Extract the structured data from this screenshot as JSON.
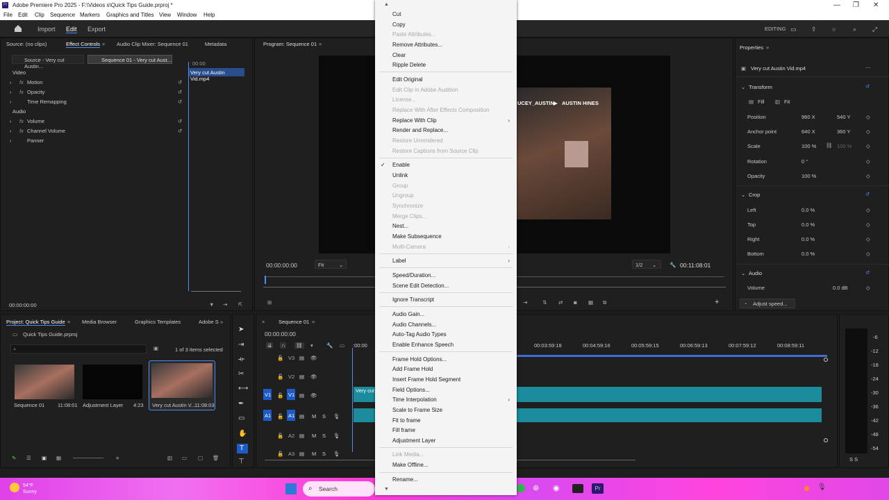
{
  "window": {
    "title": "Adobe Premiere Pro 2025 - F:\\Videos s\\Quick Tips Guide.prproj *"
  },
  "menubar": [
    "File",
    "Edit",
    "Clip",
    "Sequence",
    "Markers",
    "Graphics and Titles",
    "View",
    "Window",
    "Help"
  ],
  "topnav": {
    "import": "Import",
    "edit": "Edit",
    "export": "Export",
    "editing": "EDITING"
  },
  "effect_controls": {
    "tabs": [
      "Source: (no clips)",
      "Effect Controls",
      "Audio Clip Mixer: Sequence 01",
      "Metadata"
    ],
    "source_label": "Source - Very cut Austin...",
    "seq_label": "Sequence 01 - Very cut Aust...",
    "timecode_start": "00:00",
    "clip_name": "Very cut Austin Vid.mp4",
    "video_header": "Video",
    "audio_header": "Audio",
    "effects": [
      "Motion",
      "Opacity",
      "Time Remapping"
    ],
    "audio_effects": [
      "Volume",
      "Channel Volume",
      "Panner"
    ],
    "time": "00:00:00:00"
  },
  "program": {
    "title": "Program: Sequence 01",
    "overlay_name1": "UCEY_AUSTIN",
    "overlay_name2": "AUSTIN HINES",
    "time": "00:00:00:00",
    "fit": "Fit",
    "quality": "1/2",
    "duration": "00:11:08:01"
  },
  "properties": {
    "title": "Properties",
    "clip": "Very cut Austin Vid.mp4",
    "transform": "Transform",
    "fill": "Fill",
    "fitlabel": "Fit",
    "rows": [
      {
        "label": "Position",
        "v1": "960 X",
        "v2": "540 Y"
      },
      {
        "label": "Anchor point",
        "v1": "640 X",
        "v2": "360 Y"
      },
      {
        "label": "Scale",
        "v1": "100 %",
        "v2": "100 %"
      },
      {
        "label": "Rotation",
        "v1": "0 °",
        "v2": ""
      },
      {
        "label": "Opacity",
        "v1": "100 %",
        "v2": ""
      }
    ],
    "crop": "Crop",
    "crop_rows": [
      {
        "label": "Left",
        "v": "0.0 %"
      },
      {
        "label": "Top",
        "v": "0.0 %"
      },
      {
        "label": "Right",
        "v": "0.0 %"
      },
      {
        "label": "Bottom",
        "v": "0.0 %"
      }
    ],
    "audio": "Audio",
    "volume_label": "Volume",
    "volume_val": "0.0 dB",
    "adjust_speed": "Adjust speed..."
  },
  "project": {
    "tabs": [
      "Project: Quick Tips Guide",
      "Media Browser",
      "Graphics Templates",
      "Adobe S"
    ],
    "file": "Quick Tips Guide.prproj",
    "selected": "1 of 3 items selected",
    "items": [
      {
        "name": "Sequence 01",
        "meta": "11:08:01"
      },
      {
        "name": "Adjustment Layer",
        "meta": "4:23"
      },
      {
        "name": "Very cut Austin V...",
        "meta": "11:08:03"
      }
    ]
  },
  "timeline": {
    "title": "Sequence 01",
    "time": "00:00:00:00",
    "ruler": [
      ":00:00",
      "00:03:59:18",
      "00:04:59:16",
      "00:05:59:15",
      "00:06:59:13",
      "00:07:59:12",
      "00:08:59:11"
    ],
    "tracks": [
      "V3",
      "V2",
      "V1",
      "A1",
      "A2",
      "A3"
    ],
    "clip_label": "Very cut",
    "meter": [
      "-6",
      "-12",
      "-18",
      "-24",
      "-30",
      "-36",
      "-42",
      "-48",
      "-54"
    ],
    "meter_bottom": "S S"
  },
  "context_menu": {
    "items": [
      {
        "label": "Cut",
        "enabled": true
      },
      {
        "label": "Copy",
        "enabled": true
      },
      {
        "label": "Paste Attributes...",
        "enabled": false
      },
      {
        "label": "Remove Attributes...",
        "enabled": true
      },
      {
        "label": "Clear",
        "enabled": true
      },
      {
        "label": "Ripple Delete",
        "enabled": true
      },
      {
        "label": "Edit Original",
        "enabled": true
      },
      {
        "label": "Edit Clip In Adobe Audition",
        "enabled": false
      },
      {
        "label": "License...",
        "enabled": false
      },
      {
        "label": "Replace With After Effects Composition",
        "enabled": false
      },
      {
        "label": "Replace With Clip",
        "enabled": true,
        "submenu": true
      },
      {
        "label": "Render and Replace...",
        "enabled": true
      },
      {
        "label": "Restore Unrendered",
        "enabled": false
      },
      {
        "label": "Restore Captions from Source Clip",
        "enabled": false
      },
      {
        "label": "Enable",
        "enabled": true,
        "checked": true
      },
      {
        "label": "Unlink",
        "enabled": true
      },
      {
        "label": "Group",
        "enabled": false
      },
      {
        "label": "Ungroup",
        "enabled": false
      },
      {
        "label": "Synchronize",
        "enabled": false
      },
      {
        "label": "Merge Clips...",
        "enabled": false
      },
      {
        "label": "Nest...",
        "enabled": true
      },
      {
        "label": "Make Subsequence",
        "enabled": true
      },
      {
        "label": "Multi-Camera",
        "enabled": false,
        "submenu": true
      },
      {
        "label": "Label",
        "enabled": true,
        "submenu": true
      },
      {
        "label": "Speed/Duration...",
        "enabled": true
      },
      {
        "label": "Scene Edit Detection...",
        "enabled": true
      },
      {
        "label": "Ignore Transcript",
        "enabled": true
      },
      {
        "label": "Audio Gain...",
        "enabled": true
      },
      {
        "label": "Audio Channels...",
        "enabled": true
      },
      {
        "label": "Auto-Tag Audio Types",
        "enabled": true
      },
      {
        "label": "Enable Enhance Speech",
        "enabled": true
      },
      {
        "label": "Frame Hold Options...",
        "enabled": true
      },
      {
        "label": "Add Frame Hold",
        "enabled": true
      },
      {
        "label": "Insert Frame Hold Segment",
        "enabled": true
      },
      {
        "label": "Field Options...",
        "enabled": true
      },
      {
        "label": "Time Interpolation",
        "enabled": true,
        "submenu": true
      },
      {
        "label": "Scale to Frame Size",
        "enabled": true
      },
      {
        "label": "Fit to frame",
        "enabled": true
      },
      {
        "label": "Fill frame",
        "enabled": true
      },
      {
        "label": "Adjustment Layer",
        "enabled": true
      },
      {
        "label": "Link Media...",
        "enabled": false
      },
      {
        "label": "Make Offline...",
        "enabled": true
      },
      {
        "label": "Rename...",
        "enabled": true
      }
    ]
  },
  "taskbar": {
    "weather_temp": "54°F",
    "weather_desc": "Sunny",
    "search": "Search"
  }
}
